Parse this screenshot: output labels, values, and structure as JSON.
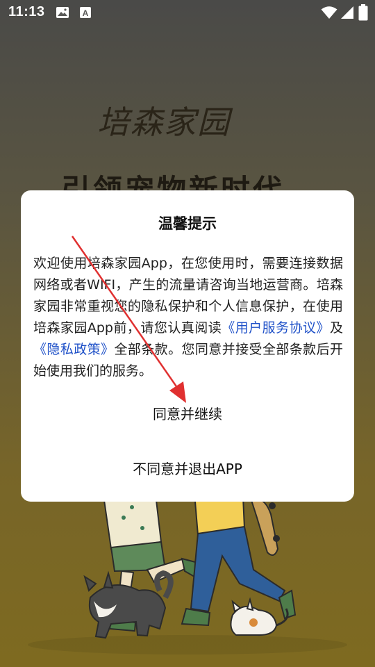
{
  "status_bar": {
    "time": "11:13",
    "left_icons": [
      "image-icon",
      "text-box-icon"
    ],
    "right_icons": [
      "wifi-icon",
      "signal-icon",
      "battery-icon"
    ]
  },
  "background": {
    "logo_text": "培森家园",
    "slogan_text": "引领宠物新时代"
  },
  "dialog": {
    "title": "温馨提示",
    "body_part1": "欢迎使用培森家园App，在您使用时，需要连接数据网络或者WIFI，产生的流量请咨询当地运营商。培森家园非常重视您的隐私保护和个人信息保护，在使用培森家园App前，请您认真阅读",
    "link_user_agreement": "《用户服务协议》",
    "body_part2": "及",
    "link_privacy_policy": "《隐私政策》",
    "body_part3": "全部条款。您同意并接受全部条款后开始使用我们的服务。",
    "agree_button": "同意并继续",
    "disagree_button": "不同意并退出APP"
  },
  "colors": {
    "link": "#1e50c8",
    "annotation_arrow": "#e03030",
    "dialog_bg": "#ffffff"
  }
}
